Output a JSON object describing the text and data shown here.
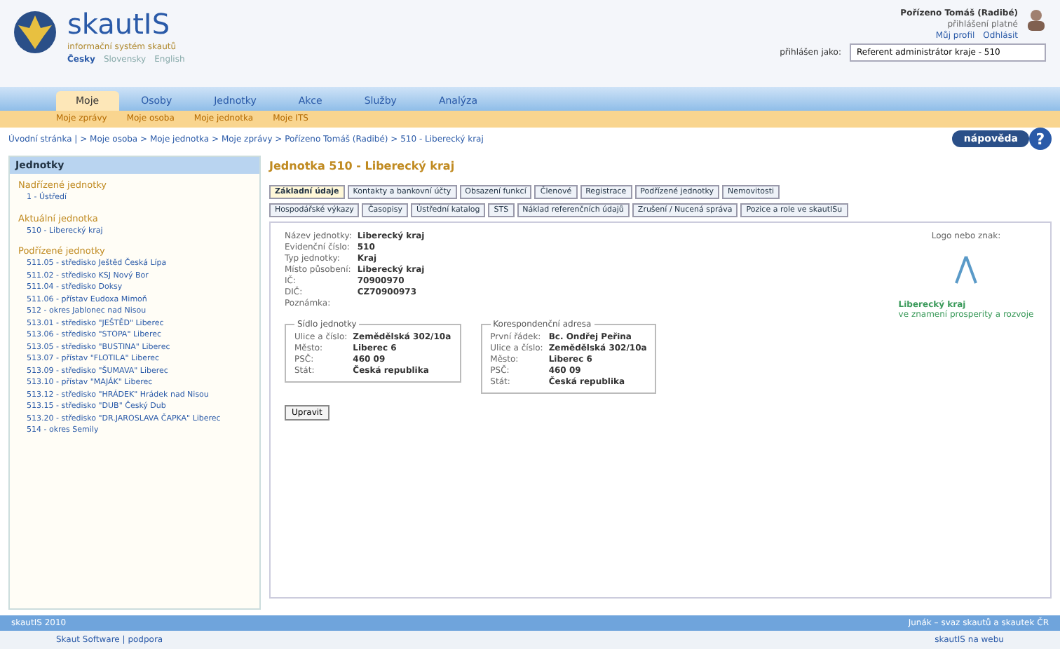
{
  "header": {
    "logo_title": "skautIS",
    "logo_subtitle": "informační systém skautů",
    "languages": [
      {
        "label": "Česky",
        "selected": true
      },
      {
        "label": "Slovensky",
        "selected": false
      },
      {
        "label": "English",
        "selected": false
      }
    ],
    "user": {
      "name": "Pořízeno Tomáš (Radibé)",
      "subtitle": "přihlášení platné",
      "links": [
        "Můj profil",
        "Odhlásit"
      ]
    },
    "role": {
      "label": "přihlášen jako:",
      "value": "Referent administrátor kraje - 510"
    }
  },
  "main_tabs": [
    {
      "label": "Moje",
      "selected": true
    },
    {
      "label": "Osoby",
      "selected": false
    },
    {
      "label": "Jednotky",
      "selected": false
    },
    {
      "label": "Akce",
      "selected": false
    },
    {
      "label": "Služby",
      "selected": false
    },
    {
      "label": "Analýza",
      "selected": false
    }
  ],
  "sub_tabs": [
    "Moje zprávy",
    "Moje osoba",
    "Moje jednotka",
    "Moje ITS"
  ],
  "breadcrumb": "Úvodní stránka | > Moje osoba > Moje jednotka > Moje zprávy > Pořízeno Tomáš (Radibé) > 510 - Liberecký kraj",
  "help_button": "nápověda",
  "help_icon": "?",
  "sidebar": {
    "title": "Jednotky",
    "sections": [
      {
        "heading": "Nadřízené jednotky",
        "items": [
          "1 - Ústředí"
        ]
      },
      {
        "heading": "Aktuální jednotka",
        "items": [
          "510 - Liberecký kraj"
        ]
      },
      {
        "heading": "Podřízené jednotky",
        "items": [
          "511.05 - středisko Ještěd Česká Lípa",
          "511.02 - středisko KSJ Nový Bor",
          "511.04 - středisko Doksy",
          "511.06 - přístav Eudoxa Mimoň",
          "512 - okres Jablonec nad Nisou",
          "513.01 - středisko \"JEŠTĚD\" Liberec",
          "513.06 - středisko \"STOPA\" Liberec",
          "513.05 - středisko \"BUSTINA\" Liberec",
          "513.07 - přístav \"FLOTILA\" Liberec",
          "513.09 - středisko \"ŠUMAVA\" Liberec",
          "513.10 - přístav \"MAJÁK\" Liberec",
          "513.12 - středisko \"HRÁDEK\" Hrádek nad Nisou",
          "513.15 - středisko \"DUB\" Český Dub",
          "513.20 - středisko \"DR.JAROSLAVA ČAPKA\" Liberec",
          "514 - okres Semily"
        ]
      }
    ]
  },
  "page_title": "Jednotka 510 - Liberecký kraj",
  "detail_tabs": [
    [
      {
        "label": "Základní údaje",
        "selected": true
      },
      {
        "label": "Kontakty a bankovní účty",
        "selected": false
      },
      {
        "label": "Obsazení funkcí",
        "selected": false
      },
      {
        "label": "Členové",
        "selected": false
      },
      {
        "label": "Registrace",
        "selected": false
      },
      {
        "label": "Podřízené jednotky",
        "selected": false
      },
      {
        "label": "Nemovitosti",
        "selected": false
      }
    ],
    [
      {
        "label": "Hospodářské výkazy",
        "selected": false
      },
      {
        "label": "Časopisy",
        "selected": false
      },
      {
        "label": "Ústřední katalog",
        "selected": false
      },
      {
        "label": "STS",
        "selected": false
      },
      {
        "label": "Náklad referenčních údajů",
        "selected": false
      },
      {
        "label": "Zrušení / Nucená správa",
        "selected": false
      },
      {
        "label": "Pozice a role ve skautISu",
        "selected": false
      }
    ]
  ],
  "fields": [
    {
      "label": "Název jednotky:",
      "value": "Liberecký kraj"
    },
    {
      "label": "Evidenční číslo:",
      "value": "510"
    },
    {
      "label": "Typ jednotky:",
      "value": "Kraj"
    },
    {
      "label": "Místo působení:",
      "value": "Liberecký kraj"
    },
    {
      "label": "IČ:",
      "value": "70900970"
    },
    {
      "label": "DIČ:",
      "value": "CZ70900973"
    },
    {
      "label": "Poznámka:"
    }
  ],
  "logo": {
    "label": "Logo nebo znak:",
    "name": "Liberecký kraj",
    "tagline": "ve znamení prosperity a rozvoje"
  },
  "addresses": [
    {
      "legend": "Sídlo jednotky",
      "rows": [
        {
          "label": "Ulice a číslo:",
          "value": "Zemědělská 302/10a"
        },
        {
          "label": "Město:",
          "value": "Liberec 6"
        },
        {
          "label": "PSČ:",
          "value": "460 09"
        },
        {
          "label": "Stát:",
          "value": "Česká republika"
        }
      ]
    },
    {
      "legend": "Korespondenční adresa",
      "rows": [
        {
          "label": "První řádek:",
          "value": "Bc. Ondřej Peřina"
        },
        {
          "label": "Ulice a číslo:",
          "value": "Zemědělská 302/10a"
        },
        {
          "label": "Město:",
          "value": "Liberec 6"
        },
        {
          "label": "PSČ:",
          "value": "460 09"
        },
        {
          "label": "Stát:",
          "value": "Česká republika"
        }
      ]
    }
  ],
  "edit_button": "Upravit",
  "footer": {
    "bar_left": "skautIS 2010",
    "bar_right": "Junák – svaz skautů a skautek ČR",
    "left": "Skaut Software | podpora",
    "right": "skautIS na webu"
  }
}
